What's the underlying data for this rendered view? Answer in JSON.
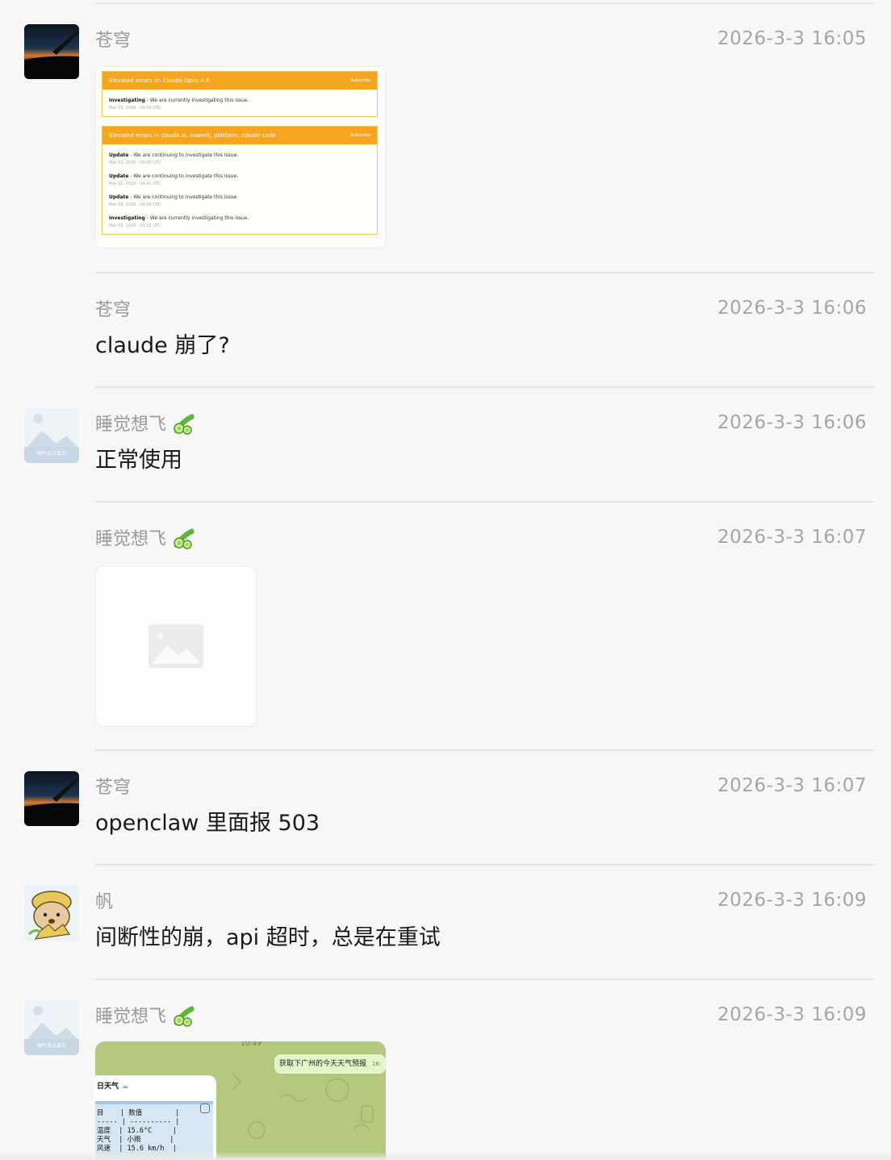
{
  "messages": [
    {
      "sender": "苍穹",
      "time": "2026-3-3 16:05",
      "type": "image",
      "image": {
        "incidents": [
          {
            "title": "Elevated errors on Claude Opus 4.6",
            "subscribe": "Subscribe",
            "entries": [
              {
                "status": "Investigating",
                "text": " - We are currently investigating this issue.",
                "date": "Mar 03, 2026 - 06:59 UTC"
              }
            ]
          },
          {
            "title": "Elevated errors in claude.ai, cowork, platform, claude code",
            "subscribe": "Subscribe",
            "entries": [
              {
                "status": "Update",
                "text": " - We are continuing to investigate this issue.",
                "date": "Mar 03, 2026 - 06:43 UTC"
              },
              {
                "status": "Update",
                "text": " - We are continuing to investigate this issue.",
                "date": "Mar 03, 2026 - 04:41 UTC"
              },
              {
                "status": "Update",
                "text": " - We are continuing to investigate this issue.",
                "date": "Mar 03, 2026 - 04:39 UTC"
              },
              {
                "status": "Investigating",
                "text": " - We are currently investigating this issue.",
                "date": "Mar 03, 2026 - 03:15 UTC"
              }
            ]
          }
        ]
      }
    },
    {
      "sender": "苍穹",
      "time": "2026-3-3 16:06",
      "type": "text",
      "text": "claude 崩了?"
    },
    {
      "sender": "睡觉想飞",
      "sender_emoji": "cucumber-icon",
      "time": "2026-3-3 16:06",
      "type": "text",
      "text": "正常使用"
    },
    {
      "sender": "睡觉想飞",
      "sender_emoji": "cucumber-icon",
      "time": "2026-3-3 16:07",
      "type": "image-placeholder"
    },
    {
      "sender": "苍穹",
      "time": "2026-3-3 16:07",
      "type": "text",
      "text": "openclaw 里面报 503"
    },
    {
      "sender": "帆",
      "time": "2026-3-3 16:09",
      "type": "text",
      "text": "间断性的崩，api 超时，总是在重试"
    },
    {
      "sender": "睡觉想飞",
      "sender_emoji": "cucumber-icon",
      "time": "2026-3-3 16:09",
      "type": "image",
      "image": {
        "top_time": "10:49",
        "bubble_text": "获取下广州的今天天气预报",
        "bubble_time": "16:",
        "card_title": "日天气",
        "table_header": "目    | 数值        |",
        "table_rule": "----- | ---------- |",
        "rows": [
          "温度  | 15.6°C     |",
          "天气  | 小雨       |",
          "风速  | 15.6 km/h  |"
        ]
      }
    }
  ],
  "avatar_labels": {
    "placeholder_caption": "图片无法显示"
  },
  "colors": {
    "background": "#f7f7f7",
    "status_orange": "#f7a51e",
    "time_gray": "#a6a6a6",
    "sender_gray": "#9a9a9a"
  }
}
